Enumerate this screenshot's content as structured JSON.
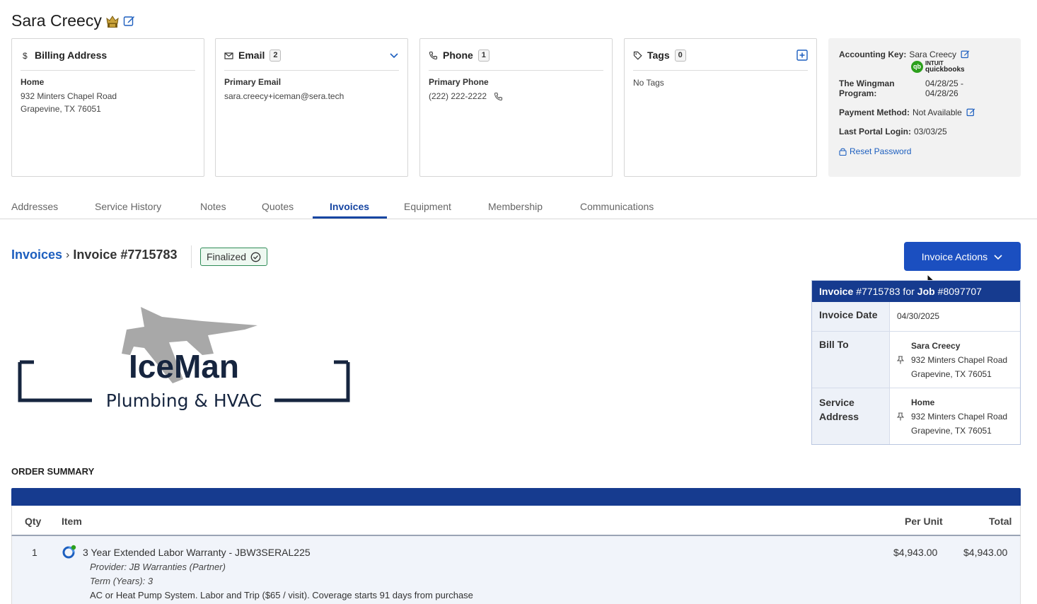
{
  "customer": {
    "name": "Sara Creecy"
  },
  "cards": {
    "billing": {
      "title": "Billing Address",
      "sub": "Home",
      "line1": "932 Minters Chapel Road",
      "line2": "Grapevine, TX 76051"
    },
    "email": {
      "title": "Email",
      "count": "2",
      "sub": "Primary Email",
      "value": "sara.creecy+iceman@sera.tech"
    },
    "phone": {
      "title": "Phone",
      "count": "1",
      "sub": "Primary Phone",
      "value": "(222) 222-2222"
    },
    "tags": {
      "title": "Tags",
      "count": "0",
      "empty": "No Tags"
    }
  },
  "account": {
    "key_label": "Accounting Key:",
    "key_value": "Sara Creecy",
    "qb_brand_top": "INTUIT",
    "qb_brand_bottom": "quickbooks",
    "qb_mark": "qb",
    "program_label_1": "The Wingman",
    "program_label_2": "Program:",
    "program_value_1": "04/28/25 -",
    "program_value_2": "04/28/26",
    "payment_label": "Payment Method:",
    "payment_value": "Not Available",
    "login_label": "Last Portal Login:",
    "login_value": "03/03/25",
    "reset_label": "Reset Password"
  },
  "tabs": [
    "Addresses",
    "Service History",
    "Notes",
    "Quotes",
    "Invoices",
    "Equipment",
    "Membership",
    "Communications"
  ],
  "breadcrumb": {
    "root": "Invoices",
    "sep": "›",
    "current": "Invoice #7715783"
  },
  "status": "Finalized",
  "actions_label": "Invoice Actions",
  "logo": {
    "title": "IceMan",
    "subtitle": "Plumbing & HVAC"
  },
  "invoice_info": {
    "head_invoice": "Invoice",
    "head_num": "#7715783 for",
    "head_job": "Job",
    "head_job_num": "#8097707",
    "date_label": "Invoice Date",
    "date_value": "04/30/2025",
    "bill_label": "Bill To",
    "bill_name": "Sara Creecy",
    "bill_line1": "932 Minters Chapel Road",
    "bill_line2": "Grapevine, TX 76051",
    "svc_label_1": "Service",
    "svc_label_2": "Address",
    "svc_name": "Home",
    "svc_line1": "932 Minters Chapel Road",
    "svc_line2": "Grapevine, TX 76051"
  },
  "order": {
    "title": "ORDER SUMMARY",
    "columns": {
      "qty": "Qty",
      "item": "Item",
      "per_unit": "Per Unit",
      "total": "Total"
    },
    "rows": [
      {
        "qty": "1",
        "item": "3 Year Extended Labor Warranty - JBW3SERAL225",
        "provider": "Provider: JB Warranties (Partner)",
        "term": "Term (Years): 3",
        "description": "AC or Heat Pump System. Labor and Trip ($65 / visit). Coverage starts 91 days from purchase",
        "per_unit": "$4,943.00",
        "total": "$4,943.00"
      }
    ]
  },
  "colors": {
    "primary": "#1b4fc0",
    "navy": "#163b8f",
    "link": "#1d5fbf",
    "success": "#2e8b57",
    "quickbooks": "#2ca01c"
  }
}
